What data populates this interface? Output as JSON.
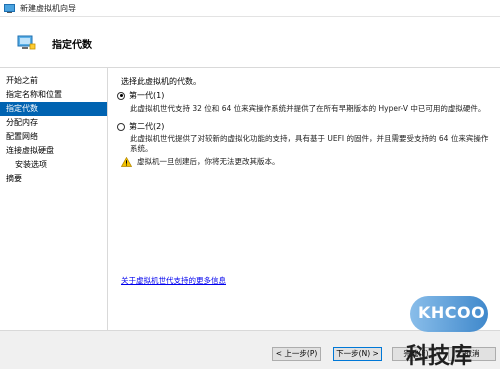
{
  "window": {
    "title": "新建虚拟机向导",
    "icon": "hyper-v-icon"
  },
  "header": {
    "page_title": "指定代数",
    "icon": "generation-icon"
  },
  "sidebar": {
    "items": [
      {
        "label": "开始之前",
        "active": false,
        "sub": false
      },
      {
        "label": "指定名称和位置",
        "active": false,
        "sub": false
      },
      {
        "label": "指定代数",
        "active": true,
        "sub": false
      },
      {
        "label": "分配内存",
        "active": false,
        "sub": false
      },
      {
        "label": "配置网络",
        "active": false,
        "sub": false
      },
      {
        "label": "连接虚拟硬盘",
        "active": false,
        "sub": false
      },
      {
        "label": "安装选项",
        "active": false,
        "sub": true
      },
      {
        "label": "摘要",
        "active": false,
        "sub": false
      }
    ]
  },
  "main": {
    "prompt": "选择此虚拟机的代数。",
    "option1": {
      "label": "第一代(1)",
      "checked": true,
      "description": "此虚拟机世代支持 32 位和 64 位来宾操作系统并提供了在所有早期版本的 Hyper-V 中已可用的虚拟硬件。"
    },
    "option2": {
      "label": "第二代(2)",
      "checked": false,
      "description": "此虚拟机世代提供了对较新的虚拟化功能的支持，具有基于 UEFI 的固件，并且需要受支持的 64 位来宾操作系统。"
    },
    "warning": {
      "icon": "warning-icon",
      "text": "虚拟机一旦创建后，你将无法更改其版本。"
    },
    "more_link": "关于虚拟机世代支持的更多信息"
  },
  "footer": {
    "prev_label": "< 上一步(P)",
    "next_label": "下一步(N) >",
    "finish_label": "完成(F)",
    "cancel_label": "取消"
  },
  "watermark": {
    "logo_text": "KHCOO",
    "site_text": "科技库"
  },
  "colors": {
    "accent": "#0063b1",
    "link": "#0000ee",
    "warning": "#f2c200"
  }
}
